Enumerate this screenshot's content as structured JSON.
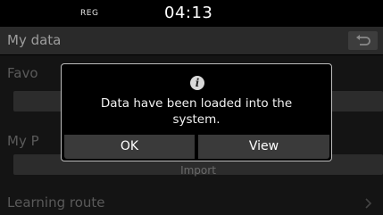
{
  "status": {
    "reg": "REG",
    "time": "04:13"
  },
  "header": {
    "title": "My data",
    "back_icon": "back-arrow-icon"
  },
  "list": {
    "favorites_label": "Favo",
    "my_places_label": "My P",
    "import_label": "Import",
    "learning_route_label": "Learning route"
  },
  "dialog": {
    "icon": "info-icon",
    "message_line1": "Data have been loaded into the",
    "message_line2": "system.",
    "ok_label": "OK",
    "view_label": "View"
  }
}
